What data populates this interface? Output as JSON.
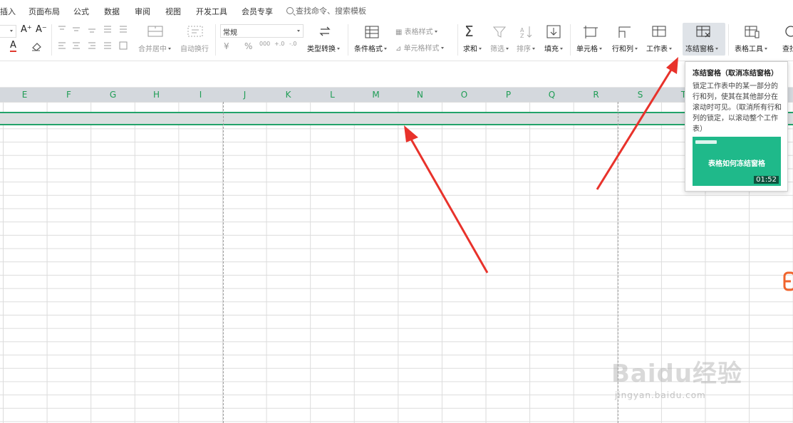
{
  "menu": {
    "items": [
      "插入",
      "页面布局",
      "公式",
      "数据",
      "审阅",
      "视图",
      "开发工具",
      "会员专享"
    ],
    "search_placeholder": "查找命令、搜索模板"
  },
  "ribbon": {
    "font_increase": "A⁺",
    "font_decrease": "A⁻",
    "font_color": "A",
    "merge_center": "合并居中",
    "wrap_text": "自动换行",
    "number_format": "常规",
    "currency": "¥",
    "percent": "%",
    "thousands": "000",
    "dec_increase": "+.0",
    "dec_decrease": "-.0",
    "type_convert": "类型转换",
    "conditional_format": "条件格式",
    "table_style": "表格样式",
    "cell_style": "单元格样式",
    "sum": "求和",
    "filter": "筛选",
    "sort": "排序",
    "fill": "填充",
    "cell": "单元格",
    "row_col": "行和列",
    "worksheet": "工作表",
    "freeze_panes": "冻结窗格",
    "table_tools": "表格工具",
    "find": "查找"
  },
  "columns": [
    "E",
    "F",
    "G",
    "H",
    "I",
    "J",
    "K",
    "L",
    "M",
    "N",
    "O",
    "P",
    "Q",
    "R",
    "S",
    "T"
  ],
  "tooltip": {
    "title": "冻结窗格（取消冻结窗格）",
    "body": "锁定工作表中的某一部分的行和列，使其在其他部分在滚动时可见。（取消所有行和列的锁定，以滚动整个工作表）",
    "video_title": "表格如何冻结窗格",
    "video_time": "01:52"
  },
  "watermark": {
    "main": "Baidu经验",
    "sub": "jingyan.baidu.com"
  },
  "colors": {
    "accent_green": "#23a36a",
    "column_letter": "#1f9d55",
    "arrow_red": "#e8322b",
    "video_bg": "#1fb98a"
  }
}
